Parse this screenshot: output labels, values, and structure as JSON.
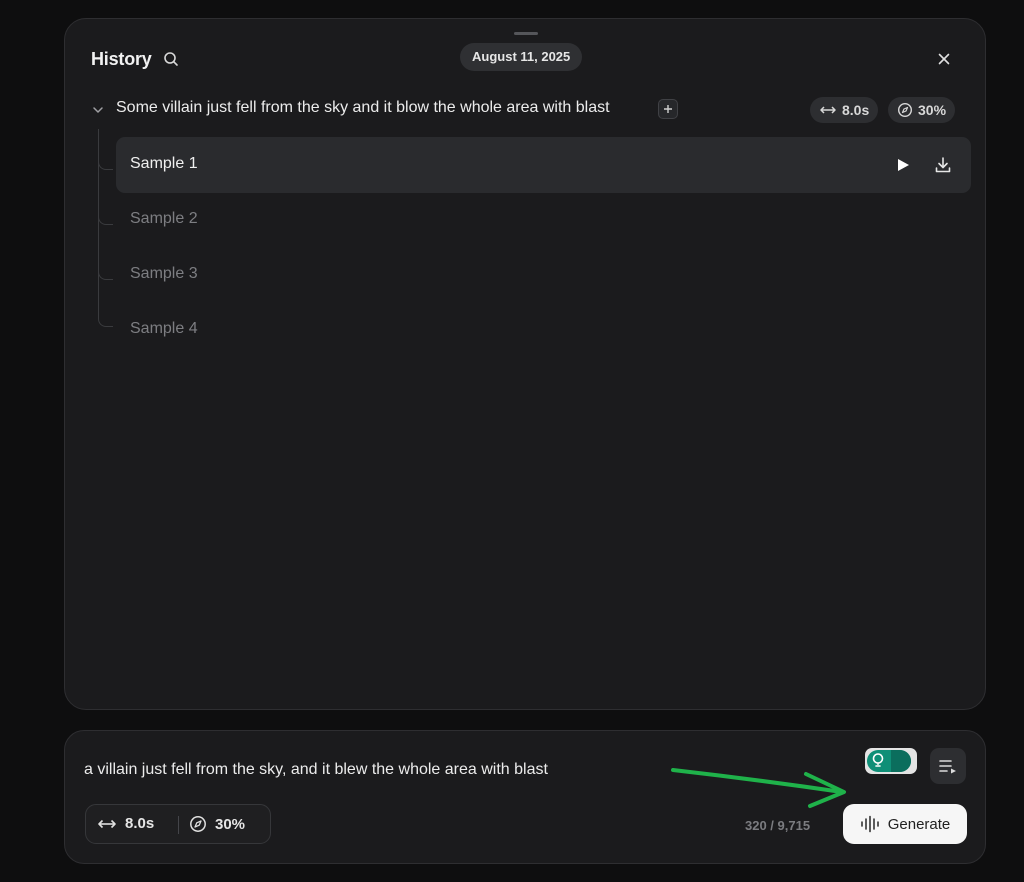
{
  "history": {
    "title": "History",
    "date": "August 11, 2025",
    "entry": {
      "prompt": "Some villain just fell from the sky and it blow the whole area with blast",
      "duration": "8.0s",
      "influence": "30%",
      "samples": [
        {
          "label": "Sample 1",
          "active": true
        },
        {
          "label": "Sample 2",
          "active": false
        },
        {
          "label": "Sample 3",
          "active": false
        },
        {
          "label": "Sample 4",
          "active": false
        }
      ]
    }
  },
  "composer": {
    "prompt_text": "a villain just fell from the sky, and it blew the whole area with blast",
    "duration": "8.0s",
    "influence": "30%",
    "char_count": "320 / 9,715",
    "generate_label": "Generate"
  },
  "colors": {
    "background": "#0e0e0f",
    "panel": "#1b1b1d",
    "toggle_accent": "#0f8f77",
    "annotation_arrow": "#1fb24a"
  },
  "icons": {
    "search": "search-icon",
    "close": "close-icon",
    "chevron": "chevron-down-icon",
    "add": "plus-icon",
    "duration": "arrows-horizontal-icon",
    "influence": "compass-icon",
    "play": "play-icon",
    "download": "download-icon",
    "assist": "lightbulb-icon",
    "options": "list-arrow-icon",
    "generate": "waveform-icon"
  }
}
